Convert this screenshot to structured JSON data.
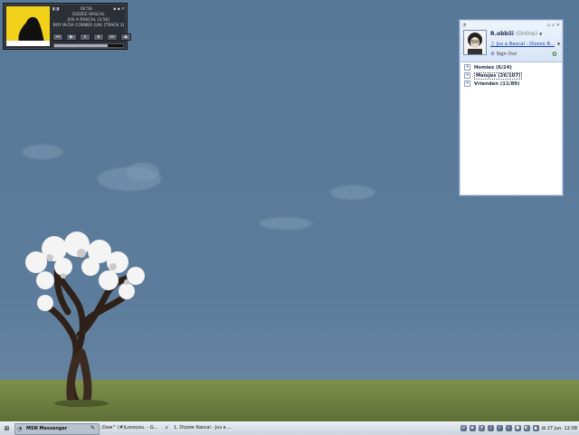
{
  "player": {
    "time": "02:56",
    "line1": "DIZZEE RASCAL",
    "line2": "JUS A RASCAL (3:56)",
    "line3": "BOY IN DA CORNER (UK) [TRACK 3]",
    "controls": [
      "⏮",
      "▶",
      "⏸",
      "⏹",
      "⏭",
      "⏏"
    ],
    "seek_fraction": 0.78
  },
  "msn": {
    "user_name": "R.obbiii",
    "status": "(Online)",
    "personal_message": "Jus a Rascal - Dizzee R...",
    "sign_out": "Sign Out",
    "groups": [
      {
        "label": "Homies (6/24)",
        "selected": false
      },
      {
        "label": "Meisjes (26/107)",
        "selected": true
      },
      {
        "label": "Vrienden (11/89)",
        "selected": false
      }
    ]
  },
  "taskbar": {
    "tasks": [
      {
        "label": "MSN Messenger",
        "active": true
      },
      {
        "label": ".:Daw^ (#)Loveyou. - G...",
        "active": false
      },
      {
        "label": "1. Dizzee Rascal - Jus a ...",
        "active": false
      }
    ],
    "clock": "di 27 jun. 12:08"
  }
}
